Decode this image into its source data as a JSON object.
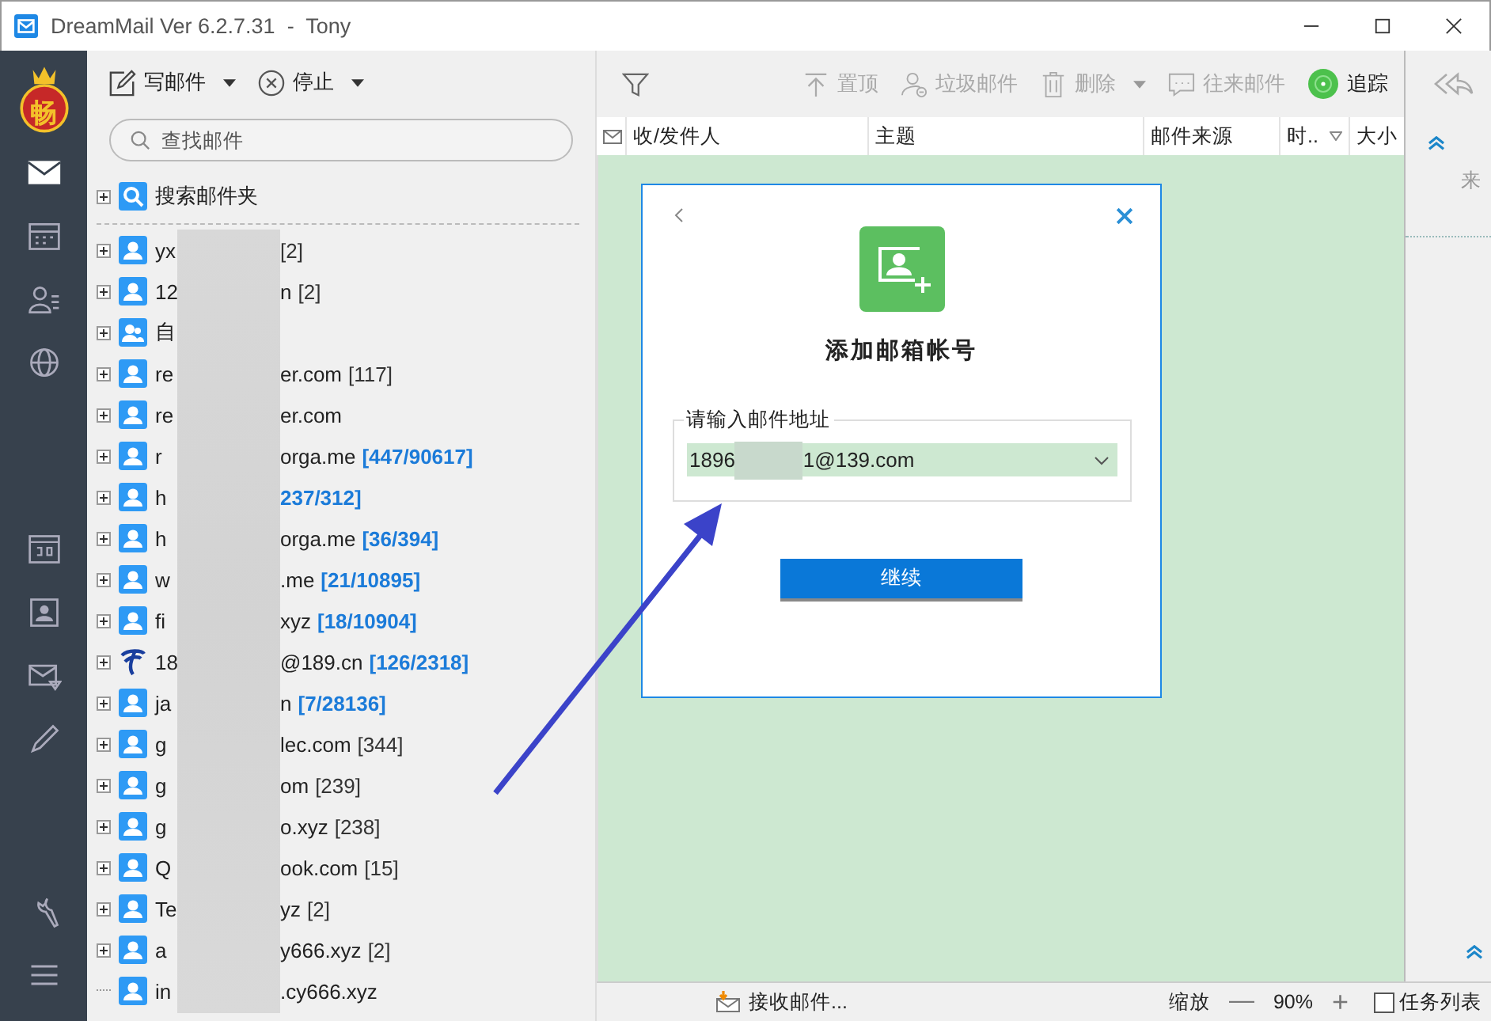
{
  "window": {
    "title": "DreamMail Ver 6.2.7.31  -  Tony"
  },
  "logo": {
    "text": "畅"
  },
  "folder_toolbar": [
    {
      "label": "写邮件",
      "kind": "compose"
    },
    {
      "label": "停止",
      "kind": "stop"
    }
  ],
  "search": {
    "placeholder": "查找邮件"
  },
  "search_folder": {
    "label": "搜索邮件夹"
  },
  "accounts": [
    {
      "prefix": "yx",
      "count": "[2]",
      "unread": false,
      "kind": "user",
      "expandable": true
    },
    {
      "prefix": "12",
      "suffix": "n",
      "count": "[2]",
      "unread": false,
      "kind": "user",
      "expandable": true
    },
    {
      "prefix": "自",
      "kind": "group",
      "expandable": true
    },
    {
      "prefix": "re",
      "suffix": "er.com",
      "count": "[117]",
      "unread": false,
      "kind": "user",
      "expandable": true
    },
    {
      "prefix": "re",
      "suffix": "er.com",
      "kind": "user",
      "expandable": true
    },
    {
      "prefix": "r",
      "suffix": "orga.me",
      "count": "[447/90617]",
      "unread": true,
      "kind": "user",
      "expandable": true
    },
    {
      "prefix": "h",
      "count": "237/312]",
      "unread": true,
      "kind": "user",
      "expandable": true
    },
    {
      "prefix": "h",
      "suffix": "orga.me",
      "count": "[36/394]",
      "unread": true,
      "kind": "user",
      "expandable": true
    },
    {
      "prefix": "w",
      "suffix": ".me",
      "count": "[21/10895]",
      "unread": true,
      "kind": "user",
      "expandable": true
    },
    {
      "prefix": "fi",
      "suffix": "xyz",
      "count": "[18/10904]",
      "unread": true,
      "kind": "user",
      "expandable": true
    },
    {
      "prefix": "18",
      "suffix": "@189.cn",
      "count": "[126/2318]",
      "unread": true,
      "kind": "telecom",
      "expandable": true
    },
    {
      "prefix": "ja",
      "suffix": "n",
      "count": "[7/28136]",
      "unread": true,
      "kind": "user",
      "expandable": true
    },
    {
      "prefix": "g",
      "suffix": "lec.com",
      "count": "[344]",
      "unread": false,
      "kind": "user",
      "expandable": true
    },
    {
      "prefix": "g",
      "suffix": "om",
      "count": "[239]",
      "unread": false,
      "kind": "user",
      "expandable": true
    },
    {
      "prefix": "g",
      "suffix": "o.xyz",
      "count": "[238]",
      "unread": false,
      "kind": "user",
      "expandable": true
    },
    {
      "prefix": "Q",
      "suffix": "ook.com",
      "count": "[15]",
      "unread": false,
      "kind": "user",
      "expandable": true
    },
    {
      "prefix": "Te",
      "suffix": "yz",
      "count": "[2]",
      "unread": false,
      "kind": "user",
      "expandable": true
    },
    {
      "prefix": "a",
      "suffix": "y666.xyz",
      "count": "[2]",
      "unread": false,
      "kind": "user",
      "expandable": true
    },
    {
      "prefix": "in",
      "suffix": ".cy666.xyz",
      "kind": "user",
      "expandable": false
    }
  ],
  "mail_toolbar": [
    {
      "label": "置顶",
      "kind": "pin",
      "disabled": true,
      "dropdown": false
    },
    {
      "label": "垃圾邮件",
      "kind": "spam",
      "disabled": true,
      "dropdown": false
    },
    {
      "label": "删除",
      "kind": "trash",
      "disabled": true,
      "dropdown": true
    },
    {
      "label": "往来邮件",
      "kind": "chat",
      "disabled": true,
      "dropdown": false
    },
    {
      "label": "追踪",
      "kind": "radar",
      "disabled": false,
      "dropdown": false
    }
  ],
  "columns": [
    "收/发件人",
    "主题",
    "邮件来源",
    "时..",
    "大小"
  ],
  "dialog": {
    "title": "添加邮箱帐号",
    "field_label": "请输入邮件地址",
    "value_start": "1896",
    "value_end": "1@139.com",
    "button": "继续"
  },
  "preview": {
    "label": "来"
  },
  "status_bar": {
    "receiving": "接收邮件...",
    "zoom_label": "缩放",
    "zoom_minus": "—",
    "zoom": "90%",
    "zoom_plus": "+",
    "task_list": {
      "label": "任务列表",
      "checked": false
    }
  }
}
